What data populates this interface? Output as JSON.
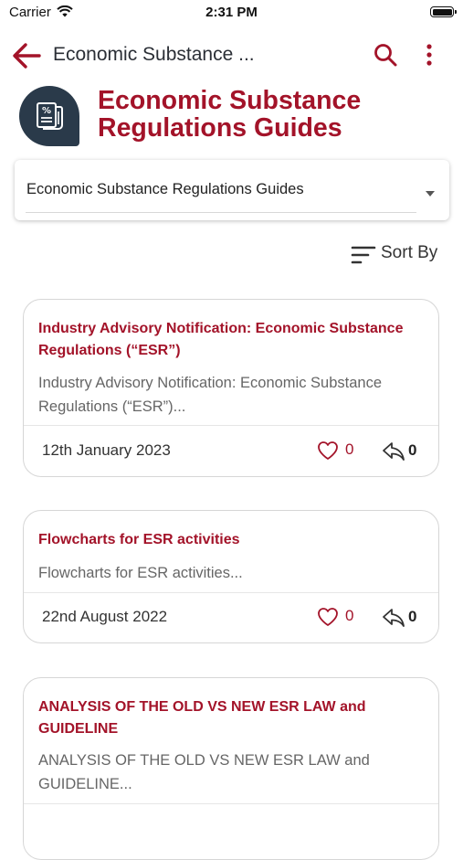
{
  "status_bar": {
    "carrier": "Carrier",
    "time": "2:31 PM"
  },
  "app_bar": {
    "title": "Economic Substance ..."
  },
  "header": {
    "title": "Economic Substance Regulations Guides",
    "logo_icon": "percent-document-icon"
  },
  "dropdown": {
    "selected": "Economic Substance Regulations Guides"
  },
  "sort": {
    "label": "Sort By"
  },
  "colors": {
    "accent": "#a31329",
    "logo_bg": "#2a3a4a"
  },
  "cards": [
    {
      "title": "Industry Advisory Notification: Economic Substance Regulations (“ESR”)",
      "description": "Industry Advisory Notification: Economic Substance Regulations (“ESR”)...",
      "date": "12th January 2023",
      "likes": "0",
      "shares": "0"
    },
    {
      "title": "Flowcharts for ESR activities",
      "description": "Flowcharts for ESR activities...",
      "date": "22nd August 2022",
      "likes": "0",
      "shares": "0"
    },
    {
      "title": "ANALYSIS OF THE OLD VS NEW ESR LAW and GUIDELINE",
      "description": "ANALYSIS OF THE OLD VS NEW ESR LAW and GUIDELINE...",
      "date": "",
      "likes": "",
      "shares": ""
    }
  ]
}
